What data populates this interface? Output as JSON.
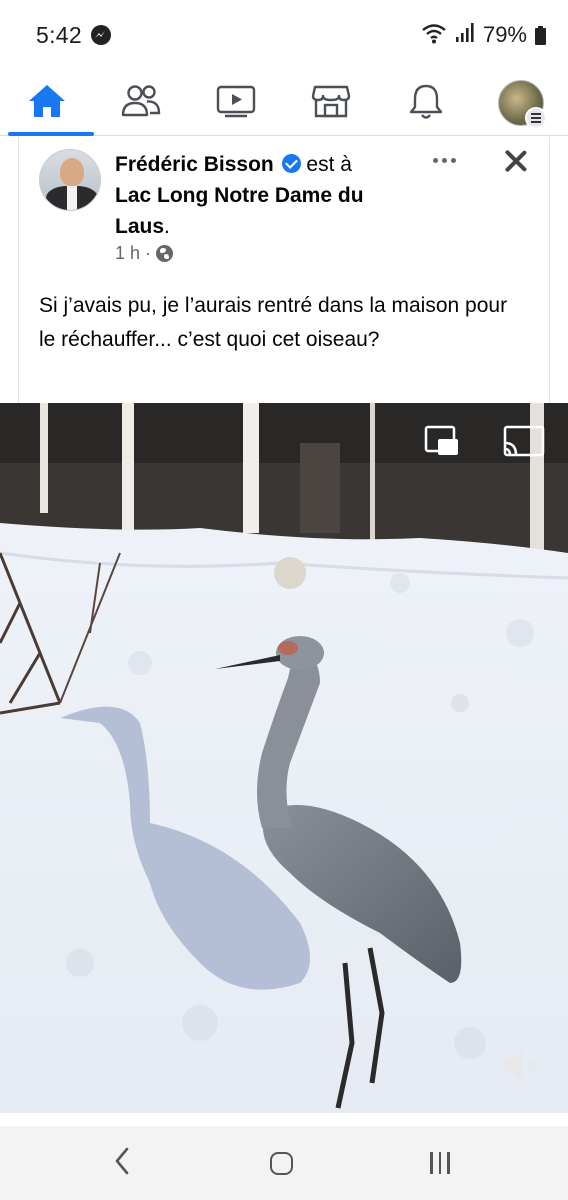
{
  "status_bar": {
    "time": "5:42",
    "battery": "79%"
  },
  "nav": {
    "items": [
      {
        "icon": "home-icon",
        "active": true
      },
      {
        "icon": "friends-icon",
        "active": false
      },
      {
        "icon": "video-icon",
        "active": false
      },
      {
        "icon": "marketplace-icon",
        "active": false
      },
      {
        "icon": "bell-icon",
        "active": false
      },
      {
        "icon": "profile-avatar",
        "active": false
      }
    ],
    "accent_color": "#1877f2"
  },
  "post": {
    "author": "Frédéric Bisson",
    "connector": "est à",
    "place_line1": "Lac Long Notre Dame du",
    "place_line2": "Laus",
    "place_suffix": ".",
    "time": "1 h",
    "separator": "·",
    "privacy_icon": "globe-icon",
    "text": "Si j’avais pu, je l’aurais rentré dans la maison pour le réchauffer... c’est quoi cet oiseau?",
    "photo_subject": "sandhill crane standing in snow"
  },
  "video_controls": {
    "icons": [
      "picture-in-picture-icon",
      "cast-icon",
      "mute-icon"
    ]
  },
  "android_nav": {
    "icons": [
      "back-icon",
      "home-icon",
      "recents-icon"
    ]
  }
}
